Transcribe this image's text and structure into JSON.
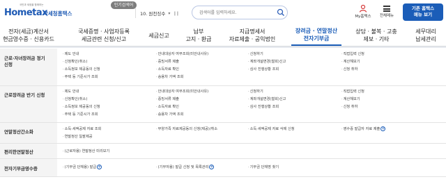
{
  "logo": {
    "slogan": "국민과 세정을 함께하는",
    "word": "Hometax",
    "org": "국세청홈택스"
  },
  "hot_search": {
    "badge": "인기검색어",
    "current": "10. 원천징수"
  },
  "search": {
    "placeholder": "검색어를 입력하세요."
  },
  "utility": {
    "my_home": "My홈택스",
    "menu_all": "전체메뉴"
  },
  "basic_button": {
    "line1": "기존 홈택스",
    "line2": "메뉴 보기"
  },
  "nav": [
    {
      "line1": "전자(세금)계산서",
      "line2": "현금영수증 · 신용카드"
    },
    {
      "line1": "국세증명 · 사업자등록",
      "line2": "세금관련 신청/신고"
    },
    {
      "line1": "세금신고",
      "line2": ""
    },
    {
      "line1": "납부",
      "line2": "고지 · 환급"
    },
    {
      "line1": "지급명세서",
      "line2": "자료제출 · 공익법인"
    },
    {
      "line1": "장려금 · 연말정산",
      "line2": "전자기부금"
    },
    {
      "line1": "상담 · 불복 · 고충",
      "line2": "제보 · 기타"
    },
    {
      "line1": "세무대리",
      "line2": "납세관리"
    }
  ],
  "sections": [
    {
      "title_line1": "근로·자녀장려금 정기",
      "title_line2": "신청",
      "columns": [
        [
          "제도 안내",
          "신청확인(취소)",
          "소득정보 제공동의 신청",
          "주택 등 기준시가 조회"
        ],
        [
          "안내대상자 여부조회(미안내사유)",
          "증빙서류 제출",
          "소득자료 확인",
          "승용차 가액 조회"
        ],
        [
          "신청하기",
          "계좌개설변경(철회)신고",
          "심사 진행상황 조회"
        ],
        [
          "직접입력 신청",
          "계산해보기",
          "신청 취하"
        ]
      ]
    },
    {
      "title_line1": "근로장려금 반기 신청",
      "title_line2": "",
      "columns": [
        [
          "제도 안내",
          "신청확인(취소)",
          "소득정보 제공동의 신청",
          "주택 등 기준시가 조회"
        ],
        [
          "안내대상자 여부조회(미안내사유)",
          "증빙서류 제출",
          "소득자료 확인",
          "승용차 가액 조회"
        ],
        [
          "신청하기",
          "계좌개설변경(철회)신고",
          "심사 진행상황 조회"
        ],
        [
          "직접입력 신청",
          "계산해보기",
          "신청 취하"
        ]
      ]
    },
    {
      "title_line1": "연말정산간소화",
      "items": [
        "소득·세액공제 자료 조회",
        "연말정산 일괄제공",
        "부양가족 자료제공동의 신청(제공)/취소",
        "소득·세액공제 자료 삭제 신청",
        "영수증 발급자 자료 제출"
      ]
    },
    {
      "title_line1": "편리한연말정산",
      "items": [
        "(근로자용) 연말정산 미리보기"
      ]
    },
    {
      "title_line1": "전자기부금영수증",
      "items": [
        "(기부금 단체용) 발급",
        "(기부자용) 발급 신청 및 목록관리",
        "기부금 단체명 찾기"
      ]
    }
  ],
  "colors": {
    "brand": "#1b5db8",
    "head_bg": "#f4f4f4"
  }
}
